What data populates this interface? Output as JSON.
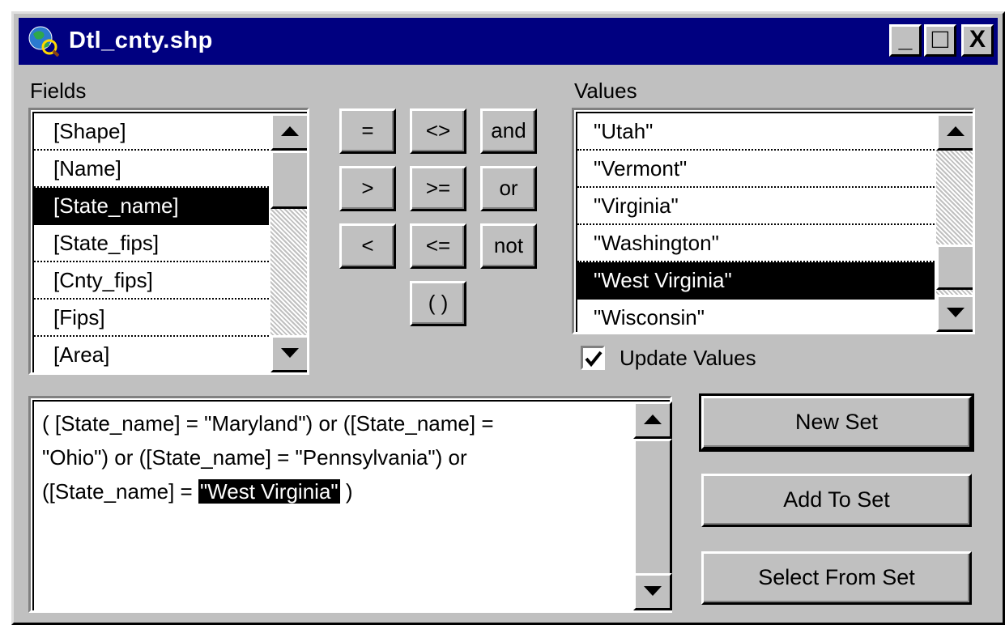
{
  "window": {
    "title": "Dtl_cnty.shp",
    "minimize_glyph": "_",
    "maximize_glyph": "□",
    "close_glyph": "X"
  },
  "fields": {
    "label": "Fields",
    "items": [
      "[Shape]",
      "[Name]",
      "[State_name]",
      "[State_fips]",
      "[Cnty_fips]",
      "[Fips]",
      "[Area]"
    ],
    "selected": "[State_name]"
  },
  "operators": {
    "eq": "=",
    "ne": "<>",
    "and": "and",
    "gt": ">",
    "ge": ">=",
    "or": "or",
    "lt": "<",
    "le": "<=",
    "not": "not",
    "paren": "( )"
  },
  "values": {
    "label": "Values",
    "items": [
      "\"Utah\"",
      "\"Vermont\"",
      "\"Virginia\"",
      "\"Washington\"",
      "\"West Virginia\"",
      "\"Wisconsin\""
    ],
    "selected": "\"West Virginia\""
  },
  "update_values": {
    "label": "Update Values",
    "checked": true
  },
  "expression": {
    "line1": "( [State_name] = \"Maryland\") or ([State_name] =",
    "line2": "\"Ohio\") or ([State_name] = \"Pennsylvania\") or",
    "line3_prefix": "([State_name] = ",
    "line3_highlight": "\"West Virginia\"",
    "line3_suffix": " )"
  },
  "buttons": {
    "new_set": "New Set",
    "add_to_set": "Add To Set",
    "select_from_set": "Select From Set"
  },
  "icons": {
    "app": "globe-query-icon",
    "scroll_up": "arrow-up-icon",
    "scroll_down": "arrow-down-icon",
    "check": "checkmark-icon"
  },
  "colors": {
    "titlebar": "#000080",
    "face": "#c0c0c0",
    "selection": "#000000"
  }
}
